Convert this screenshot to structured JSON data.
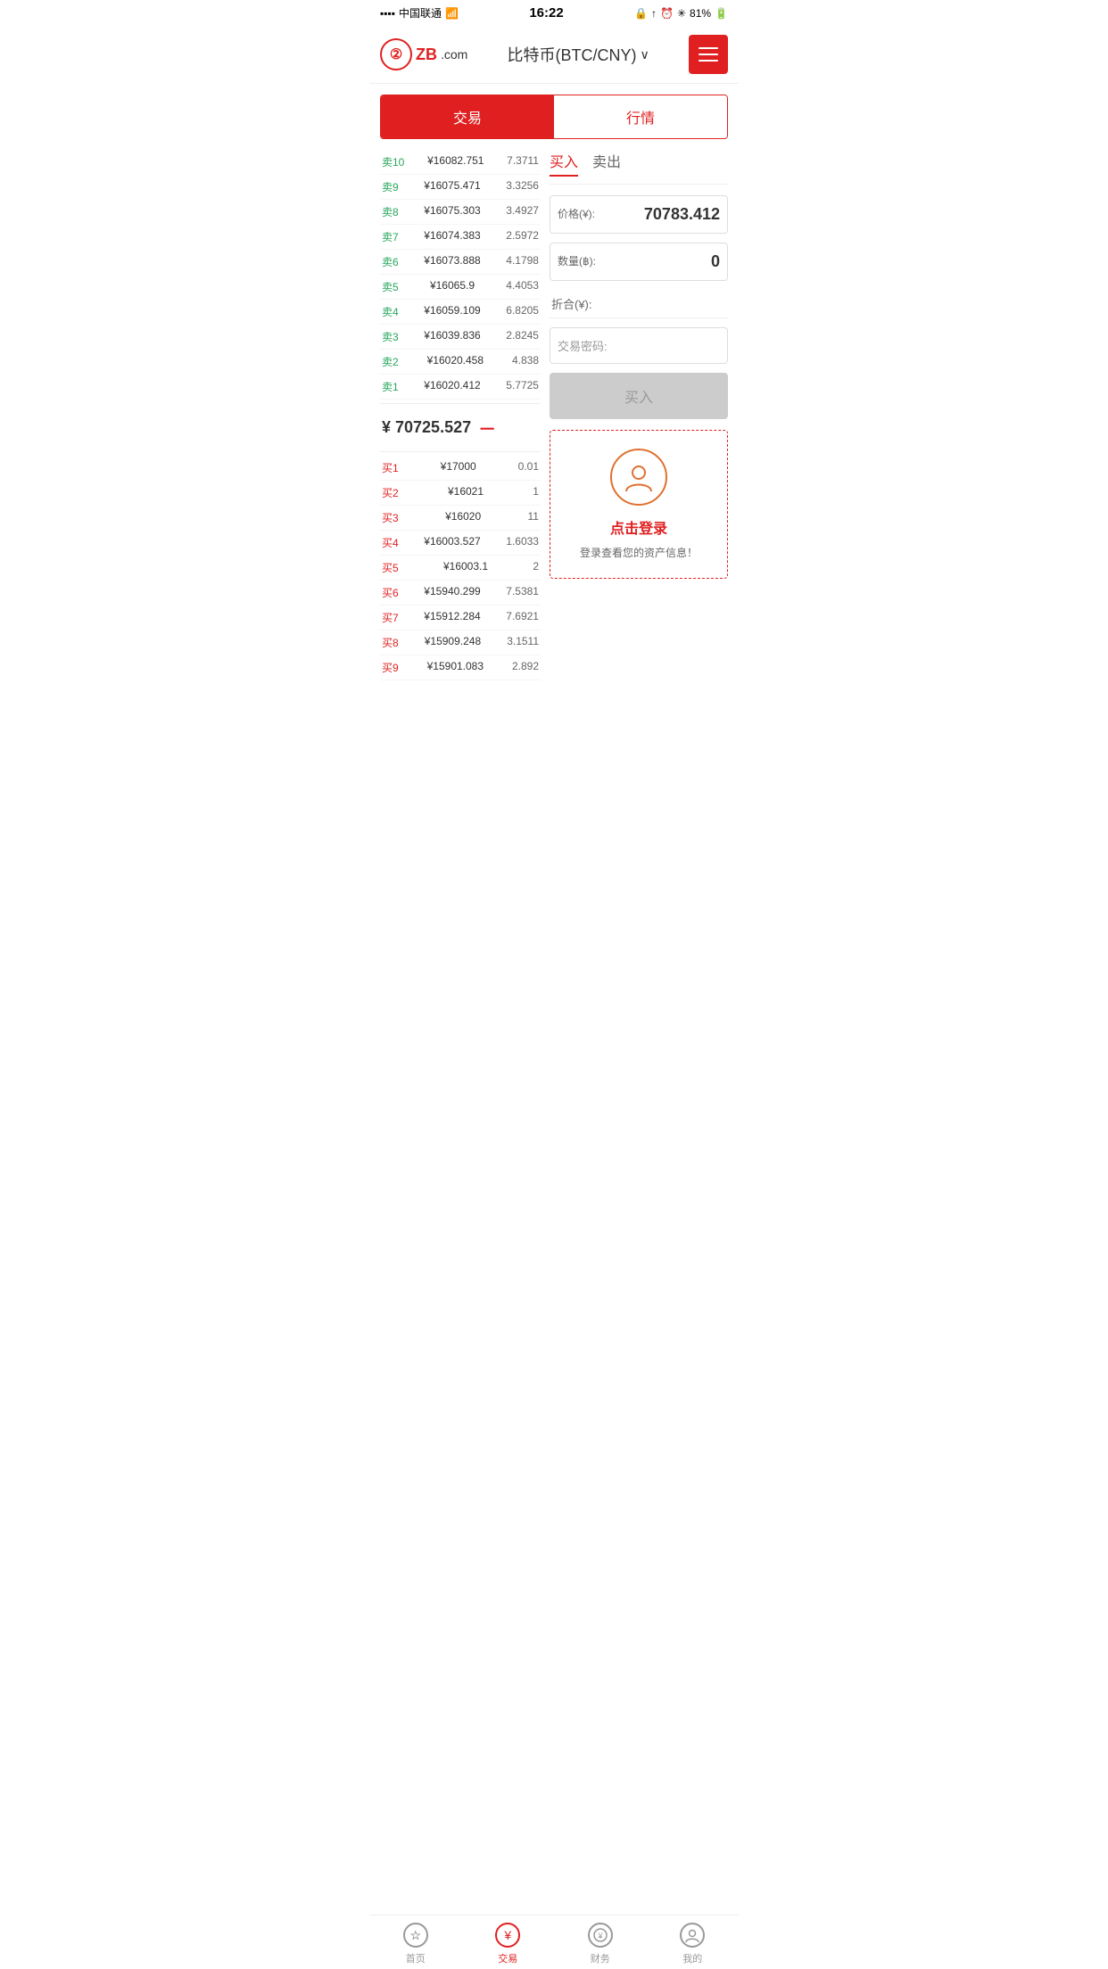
{
  "statusBar": {
    "carrier": "中国联通",
    "time": "16:22",
    "battery": "81%"
  },
  "header": {
    "logoText": "ZB",
    "logoDomain": ".com",
    "title": "比特币(BTC/CNY)",
    "menuAriaLabel": "菜单"
  },
  "tabs": {
    "trade": "交易",
    "market": "行情"
  },
  "orderBook": {
    "sellOrders": [
      {
        "label": "卖10",
        "price": "¥16082.751",
        "amount": "7.3711"
      },
      {
        "label": "卖9",
        "price": "¥16075.471",
        "amount": "3.3256"
      },
      {
        "label": "卖8",
        "price": "¥16075.303",
        "amount": "3.4927"
      },
      {
        "label": "卖7",
        "price": "¥16074.383",
        "amount": "2.5972"
      },
      {
        "label": "卖6",
        "price": "¥16073.888",
        "amount": "4.1798"
      },
      {
        "label": "卖5",
        "price": "¥16065.9",
        "amount": "4.4053"
      },
      {
        "label": "卖4",
        "price": "¥16059.109",
        "amount": "6.8205"
      },
      {
        "label": "卖3",
        "price": "¥16039.836",
        "amount": "2.8245"
      },
      {
        "label": "卖2",
        "price": "¥16020.458",
        "amount": "4.838"
      },
      {
        "label": "卖1",
        "price": "¥16020.412",
        "amount": "5.7725"
      }
    ],
    "midPrice": "¥ 70725.527",
    "midPriceSymbol": "－",
    "buyOrders": [
      {
        "label": "买1",
        "price": "¥17000",
        "amount": "0.01"
      },
      {
        "label": "买2",
        "price": "¥16021",
        "amount": "1"
      },
      {
        "label": "买3",
        "price": "¥16020",
        "amount": "11"
      },
      {
        "label": "买4",
        "price": "¥16003.527",
        "amount": "1.6033"
      },
      {
        "label": "买5",
        "price": "¥16003.1",
        "amount": "2"
      },
      {
        "label": "买6",
        "price": "¥15940.299",
        "amount": "7.5381"
      },
      {
        "label": "买7",
        "price": "¥15912.284",
        "amount": "7.6921"
      },
      {
        "label": "买8",
        "price": "¥15909.248",
        "amount": "3.1511"
      },
      {
        "label": "买9",
        "price": "¥15901.083",
        "amount": "2.892"
      }
    ]
  },
  "tradePanel": {
    "buyTab": "买入",
    "sellTab": "卖出",
    "priceLabel": "价格(¥):",
    "priceValue": "70783.412",
    "amountLabel": "数量(฿):",
    "amountValue": "0",
    "totalLabel": "折合(¥):",
    "totalValue": "",
    "passwordLabel": "交易密码:",
    "buyButton": "买入"
  },
  "loginPrompt": {
    "text": "点击登录",
    "subText": "登录查看您的资产信息！"
  },
  "bottomNav": [
    {
      "id": "home",
      "label": "首页",
      "active": false,
      "icon": "★"
    },
    {
      "id": "trade",
      "label": "交易",
      "active": true,
      "icon": "¥"
    },
    {
      "id": "finance",
      "label": "财务",
      "active": false,
      "icon": "💰"
    },
    {
      "id": "mine",
      "label": "我的",
      "active": false,
      "icon": "👤"
    }
  ]
}
